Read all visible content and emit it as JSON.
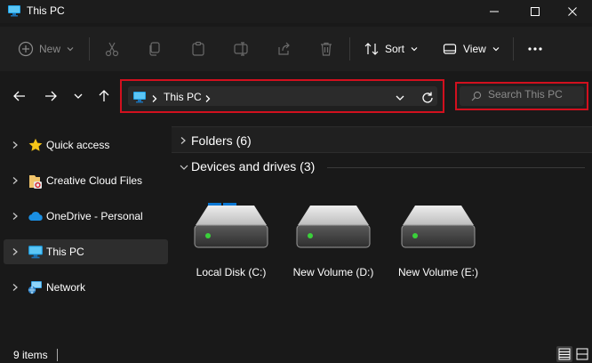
{
  "window": {
    "title": "This PC"
  },
  "toolbar": {
    "new_label": "New",
    "sort_label": "Sort",
    "view_label": "View"
  },
  "address": {
    "crumbs": [
      "This PC"
    ]
  },
  "search": {
    "placeholder": "Search This PC"
  },
  "sidebar": {
    "items": [
      {
        "label": "Quick access",
        "icon": "star-icon"
      },
      {
        "label": "Creative Cloud Files",
        "icon": "creative-cloud-folder-icon"
      },
      {
        "label": "OneDrive - Personal",
        "icon": "cloud-icon"
      },
      {
        "label": "This PC",
        "icon": "monitor-icon",
        "selected": true
      },
      {
        "label": "Network",
        "icon": "network-icon"
      }
    ]
  },
  "main": {
    "groups": [
      {
        "label": "Folders (6)",
        "expanded": false
      },
      {
        "label": "Devices and drives (3)",
        "expanded": true
      }
    ],
    "drives": [
      {
        "label": "Local Disk (C:)",
        "system_drive": true
      },
      {
        "label": "New Volume (D:)"
      },
      {
        "label": "New Volume (E:)"
      }
    ]
  },
  "status": {
    "items_count": "9 items"
  },
  "colors": {
    "background": "#191919",
    "highlight": "#d2101e",
    "accent_blue": "#0a78d4",
    "drive_led": "#3ad13a"
  }
}
